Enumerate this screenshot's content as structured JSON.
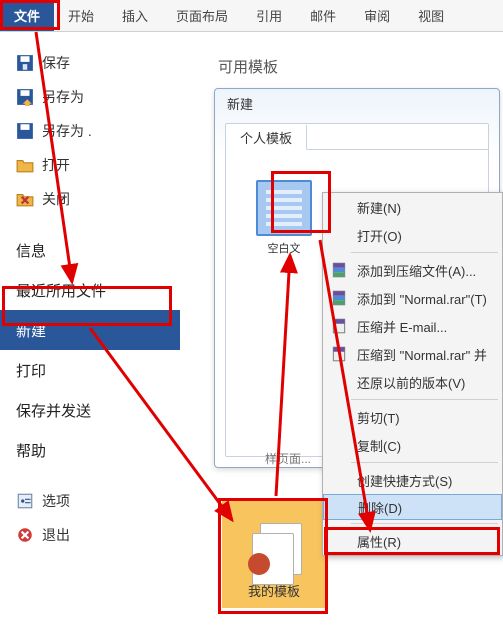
{
  "tabs": [
    {
      "label": "文件"
    },
    {
      "label": "开始"
    },
    {
      "label": "插入"
    },
    {
      "label": "页面布局"
    },
    {
      "label": "引用"
    },
    {
      "label": "邮件"
    },
    {
      "label": "审阅"
    },
    {
      "label": "视图"
    }
  ],
  "backstage": {
    "save": "保存",
    "save_as": "另存为",
    "save_as_ext": "另存为 .",
    "open": "打开",
    "close": "关闭",
    "info": "信息",
    "recent": "最近所用文件",
    "new": "新建",
    "print": "打印",
    "save_send": "保存并发送",
    "help": "帮助",
    "options": "选项",
    "exit": "退出"
  },
  "content": {
    "title": "可用模板",
    "dialog_title": "新建",
    "tab_personal": "个人模板",
    "template_caption": "空白文",
    "footer_hint": "样页面..."
  },
  "mytpl_label": "我的模板",
  "ctx": {
    "new": "新建(N)",
    "open": "打开(O)",
    "add_archive": "添加到压缩文件(A)...",
    "add_normal": "添加到 \"Normal.rar\"(T)",
    "zip_email": "压缩并 E-mail...",
    "zip_normal": "压缩到 \"Normal.rar\" 并",
    "restore": "还原以前的版本(V)",
    "cut": "剪切(T)",
    "copy": "复制(C)",
    "shortcut": "创建快捷方式(S)",
    "delete": "删除(D)",
    "props": "属性(R)"
  }
}
